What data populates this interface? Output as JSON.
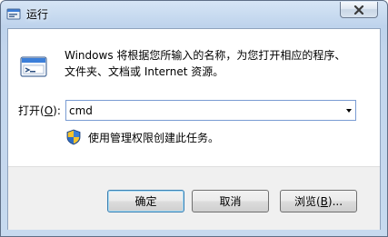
{
  "window": {
    "title": "运行",
    "title_icon": "run-icon",
    "close_icon": "close-icon"
  },
  "description": {
    "line1": "Windows 将根据您所输入的名称，为您打开相应的程序、",
    "line2": "文件夹、文档或 Internet 资源。"
  },
  "open_field": {
    "label_prefix": "打开(",
    "label_key": "O",
    "label_suffix": "):",
    "value": "cmd",
    "dropdown_icon": "chevron-down-icon"
  },
  "admin_note": {
    "icon": "uac-shield-icon",
    "text": "使用管理权限创建此任务。"
  },
  "buttons": {
    "ok": "确定",
    "cancel": "取消",
    "browse_prefix": "浏览(",
    "browse_key": "B",
    "browse_suffix": ")..."
  },
  "colors": {
    "frame": "#c3d6ed",
    "default_button_border": "#3c7fb1",
    "shield_blue": "#2f6dc2",
    "shield_yellow": "#f6c32b"
  }
}
